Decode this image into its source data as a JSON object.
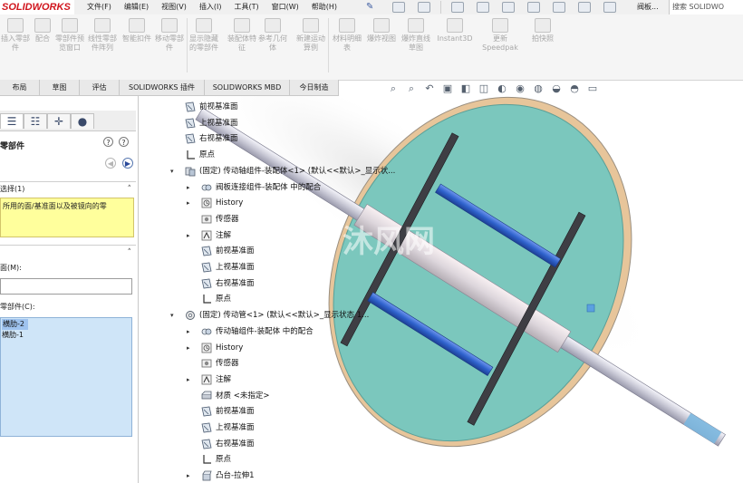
{
  "app": {
    "logo_text": "SOLIDWORKS",
    "title": "阀板...",
    "search": "搜索 SOLIDWO"
  },
  "menu": [
    "文件(F)",
    "编辑(E)",
    "视图(V)",
    "插入(I)",
    "工具(T)",
    "窗口(W)",
    "帮助(H)"
  ],
  "ribbon": [
    "插入零部件",
    "配合",
    "零部件预览窗口",
    "线性零部件阵列",
    "智能扣件",
    "移动零部件",
    "显示隐藏的零部件",
    "装配体特征",
    "参考几何体",
    "新建运动算例",
    "材料明细表",
    "爆炸视图",
    "爆炸直线草图",
    "Instant3D",
    "更新 Speedpak",
    "拍快照"
  ],
  "tabs": [
    "布局",
    "草图",
    "评估",
    "SOLIDWORKS 插件",
    "SOLIDWORKS MBD",
    "今日制造"
  ],
  "left_panel": {
    "title": "零部件",
    "section_selection": "选择(1)",
    "message": "所用的面/基准面以及被镜向的零",
    "label_face": "面(M):",
    "label_components": "零部件(C):",
    "components": [
      "横肋-2",
      "横肋-1"
    ]
  },
  "tree": [
    {
      "text": "前视基准面",
      "icon": "plane-icon"
    },
    {
      "text": "上视基准面",
      "icon": "plane-icon"
    },
    {
      "text": "右视基准面",
      "icon": "plane-icon"
    },
    {
      "text": "原点",
      "icon": "origin-icon"
    },
    {
      "text": "(固定) 传动轴组件-装配体<1> (默认<<默认>_显示状...",
      "icon": "assembly-icon"
    },
    {
      "text": "阀板连接组件-装配体 中的配合",
      "icon": "mates-icon"
    },
    {
      "text": "History",
      "icon": "history-icon"
    },
    {
      "text": "传感器",
      "icon": "sensor-icon"
    },
    {
      "text": "注解",
      "icon": "annotation-icon"
    },
    {
      "text": "前视基准面",
      "icon": "plane-icon"
    },
    {
      "text": "上视基准面",
      "icon": "plane-icon"
    },
    {
      "text": "右视基准面",
      "icon": "plane-icon"
    },
    {
      "text": "原点",
      "icon": "origin-icon"
    },
    {
      "text": "(固定) 传动管<1> (默认<<默认>_显示状态 1...",
      "icon": "part-icon"
    },
    {
      "text": "传动轴组件-装配体 中的配合",
      "icon": "mates-icon"
    },
    {
      "text": "History",
      "icon": "history-icon"
    },
    {
      "text": "传感器",
      "icon": "sensor-icon"
    },
    {
      "text": "注解",
      "icon": "annotation-icon"
    },
    {
      "text": "材质 <未指定>",
      "icon": "material-icon"
    },
    {
      "text": "前视基准面",
      "icon": "plane-icon"
    },
    {
      "text": "上视基准面",
      "icon": "plane-icon"
    },
    {
      "text": "右视基准面",
      "icon": "plane-icon"
    },
    {
      "text": "原点",
      "icon": "origin-icon"
    },
    {
      "text": "凸台-拉伸1",
      "icon": "extrude-icon"
    }
  ],
  "watermark": "沐风网",
  "colors": {
    "disc": "#7bc7bd",
    "rim": "#e7c59a",
    "bars": "#2f62cc",
    "shaft": "#cbcbd8",
    "highlight_yellow": "#ffff9c"
  }
}
